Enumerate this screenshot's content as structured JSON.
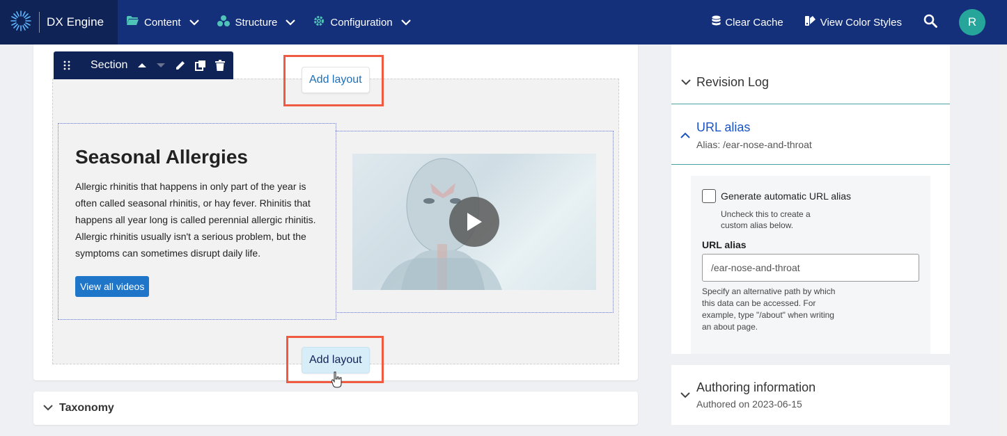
{
  "brand": {
    "name": "DX Engine"
  },
  "nav": [
    {
      "label": "Content",
      "icon": "folder-icon"
    },
    {
      "label": "Structure",
      "icon": "structure-icon"
    },
    {
      "label": "Configuration",
      "icon": "gear-icon"
    }
  ],
  "tools": {
    "clear_cache": "Clear Cache",
    "view_color_styles": "View Color Styles",
    "avatar_initial": "R"
  },
  "section_toolbar": {
    "label": "Section"
  },
  "add_layout_top": "Add layout",
  "add_layout_bottom": "Add layout",
  "content": {
    "title": "Seasonal Allergies",
    "body": "Allergic rhinitis that happens in only part of the year is often called seasonal rhinitis, or hay fever. Rhinitis that happens all year long is called perennial allergic rhinitis. Allergic rhinitis usually isn't a serious problem, but the symptoms can sometimes disrupt daily life.",
    "button": "View all videos"
  },
  "taxonomy": {
    "label": "Taxonomy"
  },
  "sidebar": {
    "revision_log": "Revision Log",
    "url_alias": {
      "title": "URL alias",
      "summary": "Alias: /ear-nose-and-throat",
      "checkbox_label": "Generate automatic URL alias",
      "checkbox_desc": "Uncheck this to create a custom alias below.",
      "field_label": "URL alias",
      "field_value": "/ear-nose-and-throat",
      "field_desc": "Specify an alternative path by which this data can be accessed. For example, type \"/about\" when writing an about page."
    },
    "authoring": {
      "title": "Authoring information",
      "summary": "Authored on 2023-06-15"
    }
  },
  "colors": {
    "nav_bg": "#15307a",
    "brand_bg": "#0f2356",
    "accent": "#1f76c9",
    "highlight": "#f05a40",
    "avatar": "#26a69a"
  }
}
